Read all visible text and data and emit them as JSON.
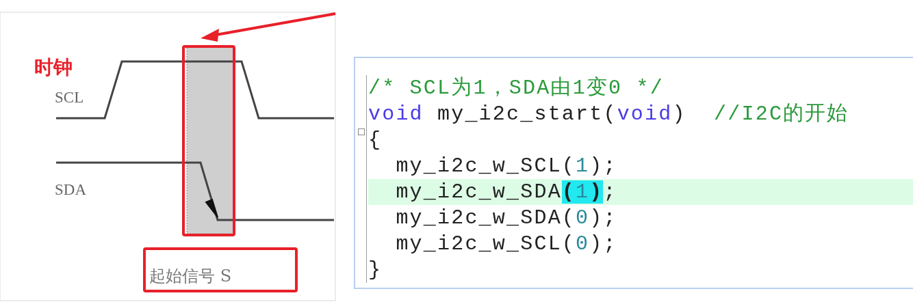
{
  "diagram": {
    "clock_label": "时钟",
    "signals": [
      {
        "name": "SCL"
      },
      {
        "name": "SDA"
      }
    ],
    "caption": "起始信号 S"
  },
  "editor": {
    "lines": [
      {
        "current": false,
        "fold": false,
        "tokens": [
          {
            "kind": "comment",
            "text": "/* SCL为1，SDA由1变0 */"
          }
        ]
      },
      {
        "current": false,
        "fold": false,
        "tokens": [
          {
            "kind": "keyword",
            "text": "void"
          },
          {
            "kind": "plain",
            "text": " my_i2c_start("
          },
          {
            "kind": "keyword",
            "text": "void"
          },
          {
            "kind": "plain",
            "text": ")  "
          },
          {
            "kind": "comment",
            "text": "//I2C的开始"
          }
        ]
      },
      {
        "current": false,
        "fold": true,
        "tokens": [
          {
            "kind": "plain",
            "text": "{"
          }
        ]
      },
      {
        "current": false,
        "fold": false,
        "tokens": [
          {
            "kind": "plain",
            "text": "  my_i2c_w_SCL("
          },
          {
            "kind": "number",
            "text": "1"
          },
          {
            "kind": "plain",
            "text": ");"
          }
        ]
      },
      {
        "current": true,
        "fold": false,
        "tokens": [
          {
            "kind": "plain",
            "text": "  my_i2c_w_SDA"
          },
          {
            "kind": "match",
            "text": "("
          },
          {
            "kind": "number",
            "text": "1",
            "caret": true
          },
          {
            "kind": "match",
            "text": ")"
          },
          {
            "kind": "plain",
            "text": ";"
          }
        ]
      },
      {
        "current": false,
        "fold": false,
        "tokens": [
          {
            "kind": "plain",
            "text": "  my_i2c_w_SDA("
          },
          {
            "kind": "number",
            "text": "0"
          },
          {
            "kind": "plain",
            "text": ");"
          }
        ]
      },
      {
        "current": false,
        "fold": false,
        "tokens": [
          {
            "kind": "plain",
            "text": "  my_i2c_w_SCL("
          },
          {
            "kind": "number",
            "text": "0"
          },
          {
            "kind": "plain",
            "text": ");"
          }
        ]
      },
      {
        "current": false,
        "fold": false,
        "tokens": [
          {
            "kind": "plain",
            "text": "}"
          }
        ]
      }
    ]
  }
}
